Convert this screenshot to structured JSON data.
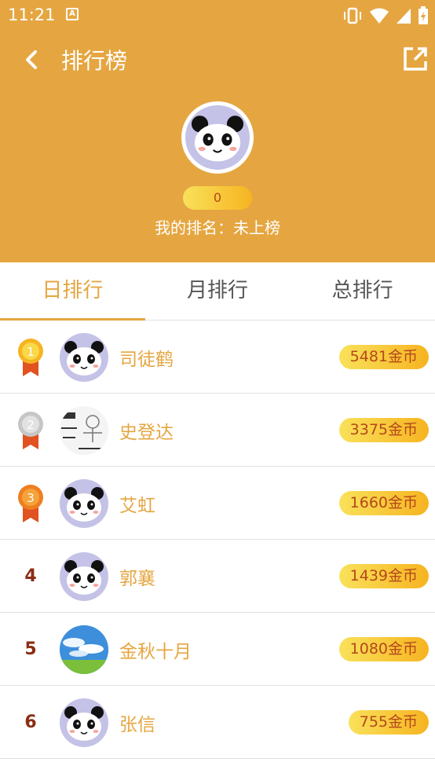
{
  "status_bar": {
    "time": "11:21",
    "notif_icon": "A"
  },
  "header": {
    "title": "排行榜",
    "my_coins": "0",
    "my_rank": "我的排名：未上榜"
  },
  "tabs": [
    {
      "label": "日排行",
      "active": true
    },
    {
      "label": "月排行",
      "active": false
    },
    {
      "label": "总排行",
      "active": false
    }
  ],
  "rankings": [
    {
      "rank": "1",
      "name": "司徒鹤",
      "coins": "5481金币",
      "avatar": "panda",
      "medal": "gold"
    },
    {
      "rank": "2",
      "name": "史登达",
      "coins": "3375金币",
      "avatar": "sketch",
      "medal": "silver"
    },
    {
      "rank": "3",
      "name": "艾虹",
      "coins": "1660金币",
      "avatar": "panda",
      "medal": "bronze"
    },
    {
      "rank": "4",
      "name": "郭襄",
      "coins": "1439金币",
      "avatar": "panda",
      "medal": null
    },
    {
      "rank": "5",
      "name": "金秋十月",
      "coins": "1080金币",
      "avatar": "sky",
      "medal": null
    },
    {
      "rank": "6",
      "name": "张信",
      "coins": "755金币",
      "avatar": "panda",
      "medal": null
    }
  ],
  "colors": {
    "primary": "#e5a641",
    "rank_text": "#8b2d14",
    "coin_text": "#b5481a"
  }
}
